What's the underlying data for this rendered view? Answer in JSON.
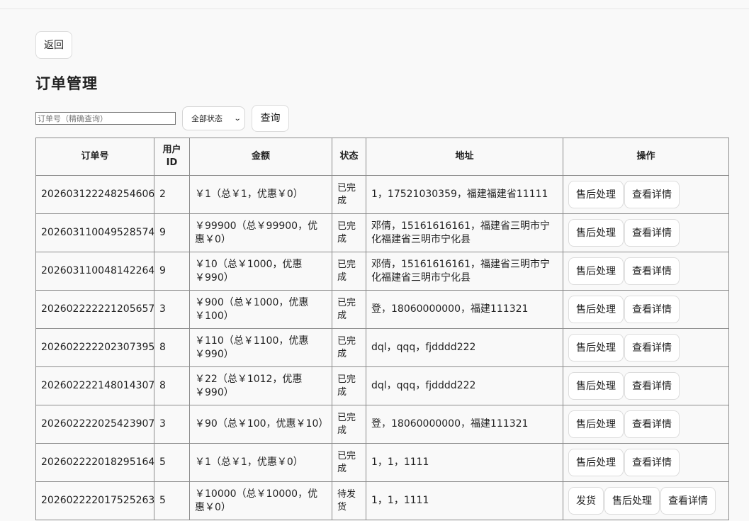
{
  "back_label": "返回",
  "page_title": "订单管理",
  "filter": {
    "order_placeholder": "订单号（精确查询）",
    "status_selected": "全部状态",
    "query_label": "查询"
  },
  "table": {
    "headers": {
      "order_id": "订单号",
      "user_id": "用户ID",
      "amount": "金额",
      "status": "状态",
      "address": "地址",
      "actions": "操作"
    },
    "rows": [
      {
        "order_id": "202603122248254606",
        "user_id": "2",
        "amount": "￥1（总￥1，优惠￥0）",
        "status": "已完成",
        "address": "1，17521030359，福建福建省11111",
        "actions": [
          "售后处理",
          "查看详情"
        ]
      },
      {
        "order_id": "202603110049528574",
        "user_id": "9",
        "amount": "￥99900（总￥99900，优惠￥0）",
        "status": "已完成",
        "address": "邓倩，15161616161，福建省三明市宁化福建省三明市宁化县",
        "actions": [
          "售后处理",
          "查看详情"
        ]
      },
      {
        "order_id": "202603110048142264",
        "user_id": "9",
        "amount": "￥10（总￥1000，优惠￥990）",
        "status": "已完成",
        "address": "邓倩，15161616161，福建省三明市宁化福建省三明市宁化县",
        "actions": [
          "售后处理",
          "查看详情"
        ]
      },
      {
        "order_id": "202602222221205657",
        "user_id": "3",
        "amount": "￥900（总￥1000，优惠￥100）",
        "status": "已完成",
        "address": "登，18060000000，福建111321",
        "actions": [
          "售后处理",
          "查看详情"
        ]
      },
      {
        "order_id": "202602222202307395",
        "user_id": "8",
        "amount": "￥110（总￥1100，优惠￥990）",
        "status": "已完成",
        "address": "dql，qqq，fjdddd222",
        "actions": [
          "售后处理",
          "查看详情"
        ]
      },
      {
        "order_id": "202602222148014307",
        "user_id": "8",
        "amount": "￥22（总￥1012，优惠￥990）",
        "status": "已完成",
        "address": "dql，qqq，fjdddd222",
        "actions": [
          "售后处理",
          "查看详情"
        ]
      },
      {
        "order_id": "202602222025423907",
        "user_id": "3",
        "amount": "￥90（总￥100，优惠￥10）",
        "status": "已完成",
        "address": "登，18060000000，福建111321",
        "actions": [
          "售后处理",
          "查看详情"
        ]
      },
      {
        "order_id": "202602222018295164",
        "user_id": "5",
        "amount": "￥1（总￥1，优惠￥0）",
        "status": "已完成",
        "address": "1，1，1111",
        "actions": [
          "售后处理",
          "查看详情"
        ]
      },
      {
        "order_id": "202602222017525263",
        "user_id": "5",
        "amount": "￥10000（总￥10000，优惠￥0）",
        "status": "待发货",
        "address": "1，1，1111",
        "actions": [
          "发货",
          "售后处理",
          "查看详情"
        ]
      }
    ]
  }
}
